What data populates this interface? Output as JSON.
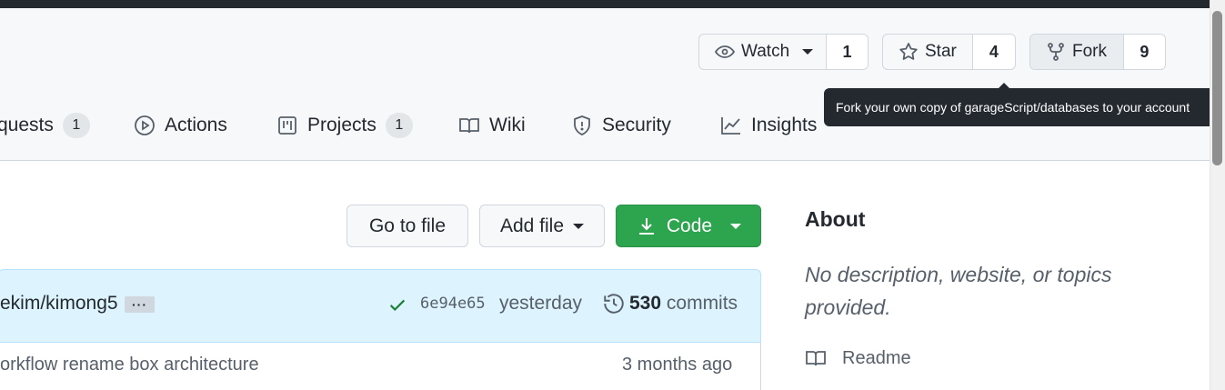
{
  "repo_actions": {
    "watch": {
      "label": "Watch",
      "count": "1"
    },
    "star": {
      "label": "Star",
      "count": "4"
    },
    "fork": {
      "label": "Fork",
      "count": "9"
    }
  },
  "tooltip": "Fork your own copy of garageScript/databases to your account",
  "tabs": [
    {
      "label": "quests",
      "count": "1",
      "icon": "pull-request-icon"
    },
    {
      "label": "Actions",
      "icon": "play-icon"
    },
    {
      "label": "Projects",
      "count": "1",
      "icon": "project-icon"
    },
    {
      "label": "Wiki",
      "icon": "book-icon"
    },
    {
      "label": "Security",
      "icon": "shield-icon"
    },
    {
      "label": "Insights",
      "icon": "graph-icon"
    }
  ],
  "toolbar": {
    "go_to_file": "Go to file",
    "add_file": "Add file",
    "code": "Code"
  },
  "latest_commit": {
    "author": "ekim/kimong5",
    "sha": "6e94e65",
    "time": "yesterday",
    "count": "530",
    "count_label": "commits"
  },
  "files": [
    {
      "message": "orkflow rename box architecture",
      "time": "3 months ago"
    }
  ],
  "about": {
    "title": "About",
    "description": "No description, website, or topics provided.",
    "readme": "Readme"
  },
  "colors": {
    "accent_green": "#2da44e",
    "commit_bg": "#ddf4ff",
    "tooltip_bg": "#24292f"
  }
}
